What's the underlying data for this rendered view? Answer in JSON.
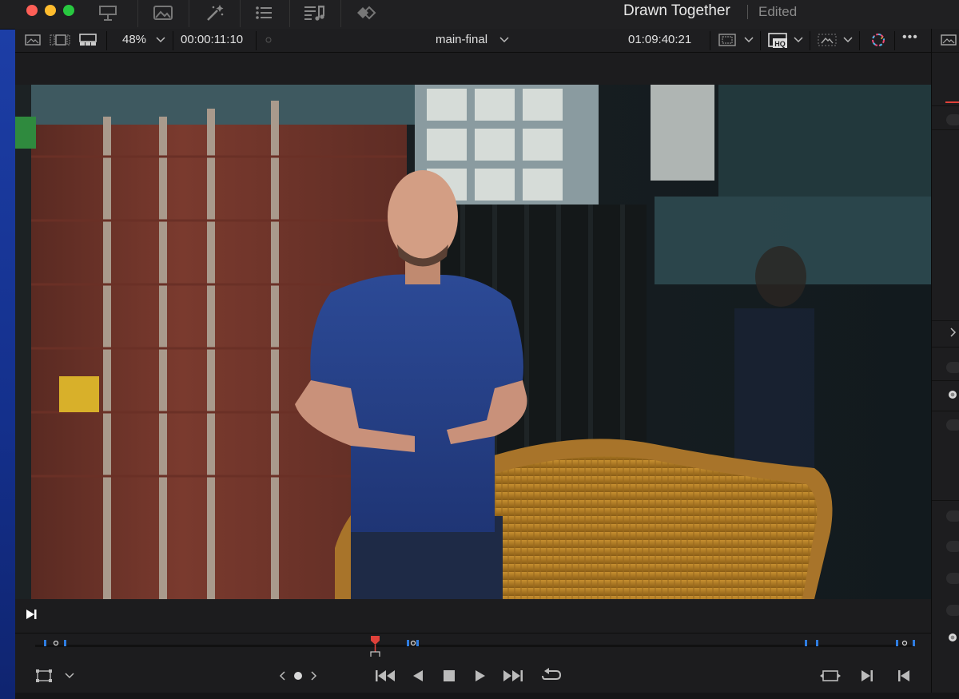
{
  "window": {
    "title": "Drawn Together",
    "status": "Edited"
  },
  "toolbar": {
    "zoom": "48%",
    "source_timecode": "00:00:11:10",
    "timeline_name": "main-final",
    "record_timecode": "01:09:40:21",
    "quality_badge": "HQ",
    "more_label": "•••"
  },
  "icons": {
    "titlebar": [
      "media-pool-icon",
      "image-icon",
      "effects-wand-icon",
      "edit-index-list-icon",
      "sound-library-icon",
      "inspector-icon"
    ],
    "toolbar": [
      "single-viewer-icon",
      "dual-viewer-icon",
      "cinema-mode-icon",
      "safe-area-icon",
      "hq-playback-icon",
      "transform-icon",
      "color-effects-icon",
      "more-options-icon",
      "panel-toggle-icon"
    ],
    "controls": [
      "crop-icon",
      "jump-to-start-icon",
      "play-reverse-icon",
      "stop-icon",
      "play-icon",
      "jump-to-end-icon",
      "loop-icon",
      "match-frame-icon",
      "mark-in-icon",
      "mark-out-icon"
    ]
  },
  "scrubber": {
    "playhead_position": 0.39
  },
  "colors": {
    "accent_red": "#e0413a",
    "marker_blue": "#2f7de1"
  }
}
